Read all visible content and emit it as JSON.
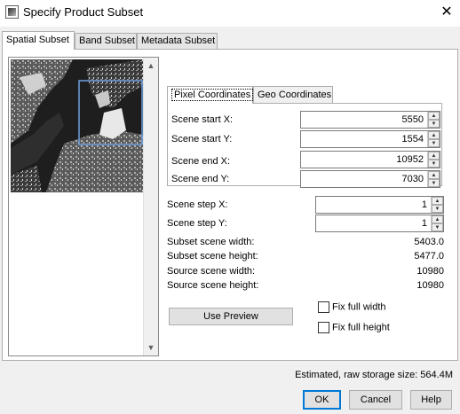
{
  "window": {
    "title": "Specify Product Subset",
    "close_glyph": "✕",
    "icon": "app-icon"
  },
  "tabs": [
    {
      "label": "Spatial Subset",
      "active": true
    },
    {
      "label": "Band Subset",
      "active": false
    },
    {
      "label": "Metadata Subset",
      "active": false
    }
  ],
  "thumbnail": {
    "scroll_up_glyph": "▲",
    "scroll_down_glyph": "▼",
    "selection_color": "#6fa0e0"
  },
  "coord_tabs": [
    {
      "label": "Pixel Coordinates",
      "active": true
    },
    {
      "label": "Geo Coordinates",
      "active": false
    }
  ],
  "pixel_fields": [
    {
      "label": "Scene start X:",
      "value": "5550"
    },
    {
      "label": "Scene start Y:",
      "value": "1554"
    },
    {
      "label": "Scene end X:",
      "value": "10952"
    },
    {
      "label": "Scene end Y:",
      "value": "7030"
    }
  ],
  "step_fields": [
    {
      "label": "Scene step X:",
      "value": "1"
    },
    {
      "label": "Scene step Y:",
      "value": "1"
    }
  ],
  "info": [
    {
      "label": "Subset scene width:",
      "value": "5403.0"
    },
    {
      "label": "Subset scene height:",
      "value": "5477.0"
    },
    {
      "label": "Source scene width:",
      "value": "10980"
    },
    {
      "label": "Source scene height:",
      "value": "10980"
    }
  ],
  "preview_button": "Use Preview",
  "checkboxes": [
    {
      "label": "Fix full width",
      "checked": false
    },
    {
      "label": "Fix full height",
      "checked": false
    }
  ],
  "storage": "Estimated, raw storage size: 564.4M",
  "buttons": {
    "ok": "OK",
    "cancel": "Cancel",
    "help": "Help"
  },
  "spinner_up_glyph": "▲",
  "spinner_down_glyph": "▼"
}
